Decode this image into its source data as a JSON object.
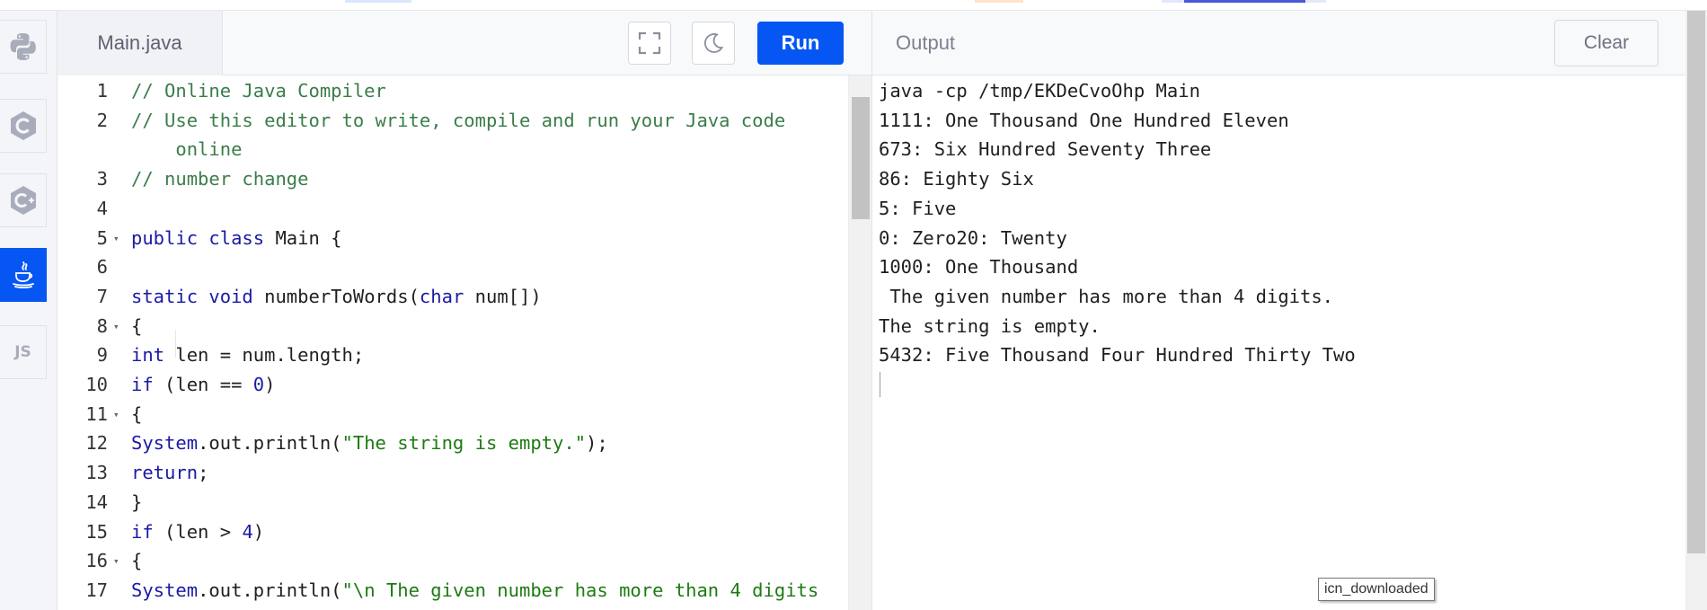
{
  "sidebar": {
    "items": [
      {
        "name": "python",
        "icon": "python-icon"
      },
      {
        "name": "c",
        "icon": "c-language-icon"
      },
      {
        "name": "cpp",
        "icon": "cpp-language-icon"
      },
      {
        "name": "java",
        "icon": "java-icon",
        "active": true
      },
      {
        "name": "javascript",
        "icon": "javascript-icon",
        "label": "JS"
      }
    ]
  },
  "editor": {
    "filename": "Main.java",
    "run_label": "Run",
    "lines": [
      {
        "no": "1",
        "fold": false,
        "tokens": [
          [
            "cm",
            "// Online Java Compiler"
          ]
        ]
      },
      {
        "no": "2",
        "fold": false,
        "tokens": [
          [
            "cm",
            "// Use this editor to write, compile and run your Java code"
          ]
        ]
      },
      {
        "no": "",
        "fold": false,
        "tokens": [
          [
            "cm",
            "    online"
          ]
        ]
      },
      {
        "no": "3",
        "fold": false,
        "tokens": [
          [
            "cm",
            "// number change"
          ]
        ]
      },
      {
        "no": "4",
        "fold": false,
        "tokens": []
      },
      {
        "no": "5",
        "fold": true,
        "tokens": [
          [
            "kw",
            "public"
          ],
          [
            "pl",
            " "
          ],
          [
            "kw",
            "class"
          ],
          [
            "pl",
            " Main {"
          ]
        ]
      },
      {
        "no": "6",
        "fold": false,
        "tokens": []
      },
      {
        "no": "7",
        "fold": false,
        "tokens": [
          [
            "kw",
            "static"
          ],
          [
            "pl",
            " "
          ],
          [
            "kw",
            "void"
          ],
          [
            "pl",
            " numberToWords("
          ],
          [
            "kw",
            "char"
          ],
          [
            "pl",
            " num[])"
          ]
        ]
      },
      {
        "no": "8",
        "fold": true,
        "tokens": [
          [
            "pl",
            "{"
          ]
        ]
      },
      {
        "no": "9",
        "fold": false,
        "tokens": [
          [
            "kw",
            "int"
          ],
          [
            "pl",
            " len = num.length;"
          ]
        ]
      },
      {
        "no": "10",
        "fold": false,
        "tokens": [
          [
            "kw",
            "if"
          ],
          [
            "pl",
            " (len == "
          ],
          [
            "nm",
            "0"
          ],
          [
            "pl",
            ")"
          ]
        ]
      },
      {
        "no": "11",
        "fold": true,
        "tokens": [
          [
            "pl",
            "{"
          ]
        ]
      },
      {
        "no": "12",
        "fold": false,
        "tokens": [
          [
            "kw",
            "System"
          ],
          [
            "pl",
            ".out.println("
          ],
          [
            "st",
            "\"The string is empty.\""
          ],
          [
            "pl",
            ");"
          ]
        ]
      },
      {
        "no": "13",
        "fold": false,
        "tokens": [
          [
            "kw",
            "return"
          ],
          [
            "pl",
            ";"
          ]
        ]
      },
      {
        "no": "14",
        "fold": false,
        "tokens": [
          [
            "pl",
            "}"
          ]
        ]
      },
      {
        "no": "15",
        "fold": false,
        "tokens": [
          [
            "kw",
            "if"
          ],
          [
            "pl",
            " (len > "
          ],
          [
            "nm",
            "4"
          ],
          [
            "pl",
            ")"
          ]
        ]
      },
      {
        "no": "16",
        "fold": true,
        "tokens": [
          [
            "pl",
            "{"
          ]
        ]
      },
      {
        "no": "17",
        "fold": false,
        "tokens": [
          [
            "kw",
            "System"
          ],
          [
            "pl",
            ".out.println("
          ],
          [
            "st",
            "\"\\n The given number has more than 4 digits"
          ]
        ]
      }
    ]
  },
  "output": {
    "title": "Output",
    "clear_label": "Clear",
    "lines": [
      "java -cp /tmp/EKDeCvoOhp Main",
      "1111: One Thousand One Hundred Eleven",
      "673: Six Hundred Seventy Three",
      "86: Eighty Six",
      "5: Five",
      "0: Zero20: Twenty",
      "1000: One Thousand",
      " The given number has more than 4 digits.",
      "The string is empty.",
      "5432: Five Thousand Four Hundred Thirty Two"
    ]
  },
  "tooltip": "icn_downloaded",
  "colors": {
    "accent": "#0556f3",
    "comment": "#3a7d4a",
    "keyword": "#1a1aa6",
    "string": "#1d7a12"
  }
}
